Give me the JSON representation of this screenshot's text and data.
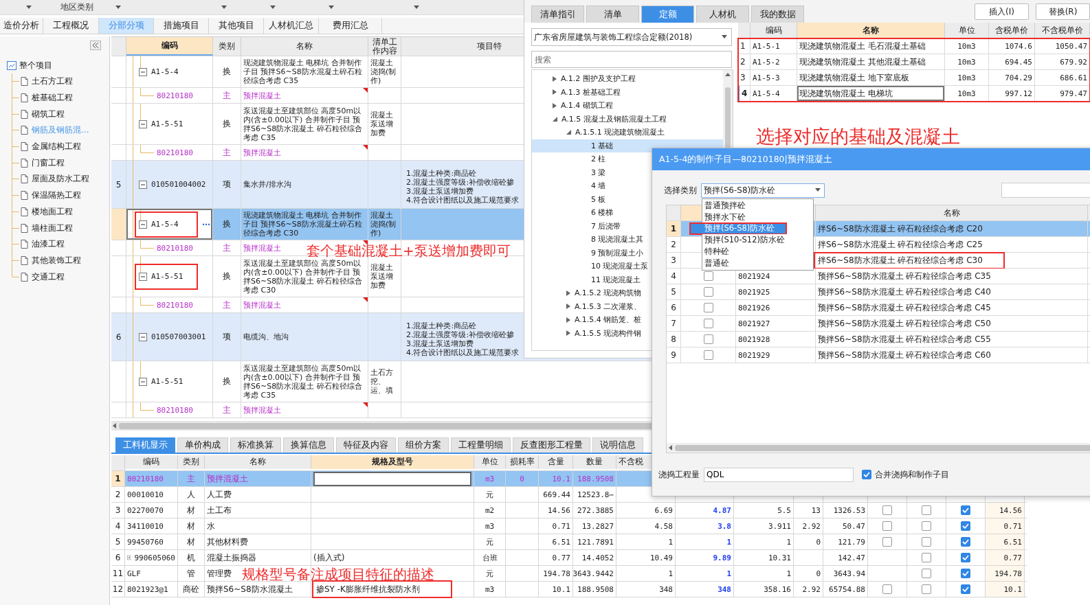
{
  "filter_bar": {
    "label": "地区类别"
  },
  "tabs": [
    {
      "label": "造价分析",
      "selected": false
    },
    {
      "label": "工程概况",
      "selected": false
    },
    {
      "label": "分部分项",
      "selected": true
    },
    {
      "label": "措施项目",
      "selected": false
    },
    {
      "label": "其他项目",
      "selected": false
    },
    {
      "label": "人材机汇总",
      "selected": false
    },
    {
      "label": "费用汇总",
      "selected": false
    }
  ],
  "tree": {
    "label": "整个项目",
    "children": [
      {
        "label": "土石方工程",
        "selected": false
      },
      {
        "label": "桩基础工程",
        "selected": false
      },
      {
        "label": "砌筑工程",
        "selected": false
      },
      {
        "label": "钢筋及钢筋混...",
        "selected": true
      },
      {
        "label": "金属结构工程",
        "selected": false
      },
      {
        "label": "门窗工程",
        "selected": false
      },
      {
        "label": "屋面及防水工程",
        "selected": false
      },
      {
        "label": "保温隔热工程",
        "selected": false
      },
      {
        "label": "楼地面工程",
        "selected": false
      },
      {
        "label": "墙柱面工程",
        "selected": false
      },
      {
        "label": "油漆工程",
        "selected": false
      },
      {
        "label": "其他装饰工程",
        "selected": false
      },
      {
        "label": "交通工程",
        "selected": false
      }
    ]
  },
  "grid": {
    "columns": [
      {
        "label": "编码",
        "active": true
      },
      {
        "label": "类别",
        "active": false
      },
      {
        "label": "名称",
        "active": false
      },
      {
        "label": "清单工作内容",
        "active": false
      },
      {
        "label": "项目特",
        "active": false
      }
    ],
    "rows": [
      {
        "kind": "sub",
        "code": "A1-5-4",
        "type": "换",
        "name": "现浇建筑物混凝土 电梯坑  合并制作子目 预拌S6~S8防水混凝土碎石粒径综合考虑 C35",
        "work": "混凝土浇捣(制作)",
        "selected": false,
        "highlighted": false
      },
      {
        "kind": "material",
        "code": "80210180",
        "type": "主",
        "name": "预拌混凝土",
        "selected": false
      },
      {
        "kind": "sub",
        "code": "A1-5-51",
        "type": "换",
        "name": "泵送混凝土至建筑部位 高度50m以内(含±0.00以下)  合并制作子目 预拌S6~S8防水混凝土 碎石粒径综合考虑 C35",
        "work": "混凝土泵送增加费",
        "selected": false,
        "highlighted": false
      },
      {
        "kind": "material",
        "code": "80210180",
        "type": "主",
        "name": "预拌混凝土",
        "selected": false
      },
      {
        "kind": "item",
        "index": "5",
        "code": "010501004002",
        "type": "项",
        "name": "集水井/排水沟",
        "features": [
          "1.混凝土种类:商品砼",
          "2.混凝土强度等级:补偿收缩砼掺",
          "3.混凝土泵送增加费",
          "4.符合设计图纸以及施工规范要求"
        ],
        "selected": false
      },
      {
        "kind": "sub",
        "code": "A1-5-4",
        "action": "⋯",
        "type": "换",
        "name": "现浇建筑物混凝土 电梯坑  合并制作子目 预拌S6~S8防水混凝土碎石粒径综合考虑 C30",
        "work": "混凝土浇捣(制作)",
        "selected": true,
        "highlighted": true
      },
      {
        "kind": "material",
        "code": "80210180",
        "type": "主",
        "name": "预拌混凝土",
        "selected": false
      },
      {
        "kind": "sub",
        "code": "A1-5-51",
        "type": "换",
        "name": "泵送混凝土至建筑部位 高度50m以内(含±0.00以下)  合并制作子目 预拌S6~S8防水混凝土 碎石粒径综合考虑 C30",
        "work": "混凝土泵送增加费",
        "selected": false,
        "highlighted": true
      },
      {
        "kind": "material",
        "code": "80210180",
        "type": "主",
        "name": "预拌混凝土",
        "selected": false
      },
      {
        "kind": "item",
        "index": "6",
        "code": "010507003001",
        "type": "项",
        "name": "电缆沟、地沟",
        "features": [
          "1.混凝土种类:商品砼",
          "2.混凝土强度等级:补偿收缩砼掺",
          "3.混凝土泵送增加费",
          "4.符合设计图纸以及施工规范要求"
        ],
        "selected": false
      },
      {
        "kind": "sub",
        "code": "A1-5-51",
        "type": "换",
        "name": "泵送混凝土至建筑部位 高度50m以内(含±0.00以下)  合并制作子目 预拌S6~S8防水混凝土 碎石粒径综合考虑 C35",
        "work": "土石方挖、运、填",
        "selected": false,
        "highlighted": false
      },
      {
        "kind": "material",
        "code": "80210180",
        "type": "主",
        "name": "预拌混凝土",
        "selected": false
      }
    ]
  },
  "bottom_tabs": [
    {
      "label": "工料机显示",
      "selected": true
    },
    {
      "label": "单价构成",
      "selected": false
    },
    {
      "label": "标准换算",
      "selected": false
    },
    {
      "label": "换算信息",
      "selected": false
    },
    {
      "label": "特征及内容",
      "selected": false
    },
    {
      "label": "组价方案",
      "selected": false
    },
    {
      "label": "工程量明细",
      "selected": false
    },
    {
      "label": "反查图形工程量",
      "selected": false
    },
    {
      "label": "说明信息",
      "selected": false
    }
  ],
  "bottom_grid": {
    "columns": [
      {
        "label": "编码",
        "active": false
      },
      {
        "label": "类别",
        "active": false
      },
      {
        "label": "名称",
        "active": false
      },
      {
        "label": "规格及型号",
        "active": true
      },
      {
        "label": "单位",
        "active": false
      },
      {
        "label": "损耗率",
        "active": false
      },
      {
        "label": "含量",
        "active": false
      },
      {
        "label": "数量",
        "active": false
      },
      {
        "label": "不含税",
        "active": false
      }
    ],
    "rows": [
      {
        "kind": "material",
        "index": "1",
        "code": "80210180",
        "type": "主",
        "name": "预拌混凝土",
        "unit": "m3",
        "loss": "0",
        "content": "10.1",
        "qty": "188.9508",
        "selected": true,
        "highlighted": false
      },
      {
        "kind": "resource",
        "index": "2",
        "code": "00010010",
        "type": "人",
        "name": "人工费",
        "unit": "元",
        "content": "669.44",
        "qty": "12523.8⋯",
        "selected": false,
        "highlighted": false
      },
      {
        "kind": "resource",
        "index": "3",
        "code": "02270070",
        "type": "材",
        "name": "土工布",
        "unit": "m2",
        "content": "14.56",
        "qty": "272.3885",
        "excl_tax": "6.69",
        "column_10": "4.87",
        "column_11": "5.5",
        "column_12": "13",
        "column_13": "1326.53",
        "column_14": {
          "checked": false
        },
        "column_15": {
          "checked": false
        },
        "column_16": {
          "checked": true
        },
        "column_17": "14.56",
        "selected": false,
        "highlighted": false
      },
      {
        "kind": "resource",
        "index": "4",
        "code": "34110010",
        "type": "材",
        "name": "水",
        "unit": "m3",
        "content": "0.71",
        "qty": "13.2827",
        "excl_tax": "4.58",
        "column_10": "3.8",
        "column_11": "3.911",
        "column_12": "2.92",
        "column_13": "50.47",
        "column_14": {
          "checked": false
        },
        "column_15": {
          "checked": false
        },
        "column_16": {
          "checked": true
        },
        "column_17": "0.71",
        "selected": false,
        "highlighted": false
      },
      {
        "kind": "resource",
        "index": "5",
        "code": "99450760",
        "type": "材",
        "name": "其他材料费",
        "unit": "元",
        "content": "6.51",
        "qty": "121.7891",
        "excl_tax": "1",
        "column_10": "1",
        "column_11": "1",
        "column_12": "0",
        "column_13": "121.79",
        "column_14": {
          "checked": false
        },
        "column_15": {
          "checked": false
        },
        "column_16": {
          "checked": true
        },
        "column_17": "6.51",
        "selected": false,
        "highlighted": false
      },
      {
        "kind": "resource",
        "index": "6",
        "expanded": false,
        "code": "990605060",
        "type": "机",
        "name": "混凝土振捣器",
        "spec": "(插入式)",
        "unit": "台班",
        "content": "0.77",
        "qty": "14.4052",
        "excl_tax": "10.49",
        "column_10": "9.89",
        "column_11": "10.31",
        "column_13": "142.47",
        "column_15": {
          "checked": false
        },
        "column_16": {
          "checked": true
        },
        "column_17": "0.77",
        "selected": false,
        "highlighted": false
      },
      {
        "kind": "resource",
        "index": "11",
        "code": "GLF",
        "type": "管",
        "name": "管理费",
        "unit": "元",
        "content": "194.78",
        "qty": "3643.9442",
        "excl_tax": "1",
        "column_10": "1",
        "column_11": "1",
        "column_12": "0",
        "column_13": "3643.94",
        "column_15": {
          "checked": false
        },
        "column_16": {
          "checked": true
        },
        "column_17": "194.78",
        "selected": false,
        "highlighted": false
      },
      {
        "kind": "resource",
        "index": "12",
        "code": "8021923@1",
        "type": "商砼",
        "name": "预拌S6~S8防水混凝土",
        "spec": "掺SY -K膨胀纤维抗裂防水剂",
        "unit": "m3",
        "content": "10.1",
        "qty": "188.9508",
        "excl_tax": "348",
        "column_10": "348",
        "column_11": "358.16",
        "column_12": "2.92",
        "column_13": "65754.88",
        "column_14": {
          "checked": false
        },
        "column_15": {
          "checked": false
        },
        "column_16": {
          "checked": true
        },
        "column_17": "10.1",
        "selected": false,
        "highlighted": true
      }
    ]
  },
  "library": {
    "tabs": [
      {
        "label": "清单指引",
        "selected": false
      },
      {
        "label": "清单",
        "selected": false
      },
      {
        "label": "定额",
        "selected": true
      },
      {
        "label": "人材机",
        "selected": false
      },
      {
        "label": "我的数据",
        "selected": false
      }
    ],
    "buttons": [
      "插入(I)",
      "替换(R)"
    ],
    "quota_set": "广东省房屋建筑与装饰工程综合定额(2018)",
    "search": {
      "placeholder": "搜索"
    },
    "tree": [
      {
        "label": "A.1.2 围护及支护工程",
        "expanded": false
      },
      {
        "label": "A.1.3 桩基础工程",
        "expanded": false
      },
      {
        "label": "A.1.4 砌筑工程",
        "expanded": false
      },
      {
        "label": "A.1.5 混凝土及钢筋混凝土工程",
        "expanded": true,
        "children": [
          {
            "label": "A.1.5.1 现浇建筑物混凝土",
            "expanded": true,
            "children": [
              {
                "label": "1 基础",
                "selected": true
              },
              {
                "label": "2 柱",
                "selected": false
              },
              {
                "label": "3 梁",
                "selected": false
              },
              {
                "label": "4 墙",
                "selected": false
              },
              {
                "label": "5 板",
                "selected": false
              },
              {
                "label": "6 楼梯",
                "selected": false
              },
              {
                "label": "7 后浇带",
                "selected": false
              },
              {
                "label": "8 现浇混凝土其",
                "selected": false
              },
              {
                "label": "9 预制混凝土小",
                "selected": false
              },
              {
                "label": "10 现浇混凝土泵",
                "selected": false
              },
              {
                "label": "11 现浇混凝土",
                "selected": false
              }
            ]
          },
          {
            "label": "A.1.5.2 现浇构筑物",
            "expanded": false
          },
          {
            "label": "A.1.5.3 二次灌浆、",
            "expanded": false
          },
          {
            "label": "A.1.5.4 钢筋笼、桩",
            "expanded": false
          },
          {
            "label": "A.1.5.5 现浇构件钢",
            "expanded": false
          }
        ]
      }
    ],
    "table": {
      "highlighted": true,
      "columns": [
        "编码",
        "名称",
        "单位",
        "含税单价",
        "不含税单价"
      ],
      "rows": [
        {
          "index": "1",
          "code": "A1-5-1",
          "name": "现浇建筑物混凝土 毛石混凝土基础",
          "unit": "10m3",
          "price_tax": "1074.6",
          "price": "1050.47",
          "selected": false
        },
        {
          "index": "2",
          "code": "A1-5-2",
          "name": "现浇建筑物混凝土 其他混凝土基础",
          "unit": "10m3",
          "price_tax": "694.45",
          "price": "679.92",
          "selected": false
        },
        {
          "index": "3",
          "code": "A1-5-3",
          "name": "现浇建筑物混凝土 地下室底板",
          "unit": "10m3",
          "price_tax": "704.29",
          "price": "686.61",
          "selected": false
        },
        {
          "index": "4",
          "code": "A1-5-4",
          "name": "现浇建筑物混凝土 电梯坑",
          "unit": "10m3",
          "price_tax": "997.12",
          "price": "979.47",
          "selected": true
        }
      ]
    }
  },
  "dialog": {
    "title": "A1-5-4的制作子目—80210180|预拌混凝土",
    "category_label": "选择类别",
    "category": "预拌(S6-S8)防水砼",
    "options": [
      {
        "label": "普通预拌砼",
        "selected": false
      },
      {
        "label": "预拌水下砼",
        "selected": false
      },
      {
        "label": "预拌(S6-S8)防水砼",
        "selected": true
      },
      {
        "label": "预拌(S10-S12)防水砼",
        "selected": false
      },
      {
        "label": "特种砼",
        "selected": false
      },
      {
        "label": "普通砼",
        "selected": false
      }
    ],
    "name_column": "名称",
    "rows": [
      {
        "index": "1",
        "name": "拌S6~S8防水混凝土 碎石粒径综合考虑 C20",
        "selected": true,
        "highlighted": false
      },
      {
        "index": "2",
        "name": "拌S6~S8防水混凝土 碎石粒径综合考虑 C25",
        "selected": false,
        "highlighted": false
      },
      {
        "index": "3",
        "name": "拌S6~S8防水混凝土 碎石粒径综合考虑 C30",
        "selected": false,
        "highlighted": true
      },
      {
        "index": "4",
        "checked": false,
        "code": "8021924",
        "name": "预拌S6~S8防水混凝土 碎石粒径综合考虑 C35",
        "selected": false,
        "highlighted": false
      },
      {
        "index": "5",
        "checked": false,
        "code": "8021925",
        "name": "预拌S6~S8防水混凝土 碎石粒径综合考虑 C40",
        "selected": false,
        "highlighted": false
      },
      {
        "index": "6",
        "checked": false,
        "code": "8021926",
        "name": "预拌S6~S8防水混凝土 碎石粒径综合考虑 C45",
        "selected": false,
        "highlighted": false
      },
      {
        "index": "7",
        "checked": false,
        "code": "8021927",
        "name": "预拌S6~S8防水混凝土 碎石粒径综合考虑 C50",
        "selected": false,
        "highlighted": false
      },
      {
        "index": "8",
        "checked": false,
        "code": "8021928",
        "name": "预拌S6~S8防水混凝土 碎石粒径综合考虑 C55",
        "selected": false,
        "highlighted": false
      },
      {
        "index": "9",
        "checked": false,
        "code": "8021929",
        "name": "预拌S6~S8防水混凝土 碎石粒径综合考虑 C60",
        "selected": false,
        "highlighted": false
      }
    ],
    "pour_label": "浇捣工程量",
    "pour_value": "QDL",
    "merge": {
      "label": "合并浇捣和制作子目",
      "checked": true
    }
  },
  "annotations": [
    {
      "text": "选择对应的基础及混凝土"
    },
    {
      "text": "套个基础混凝土+泵送增加费即可"
    },
    {
      "text": "规格型号备注成项目特征的描述"
    }
  ]
}
